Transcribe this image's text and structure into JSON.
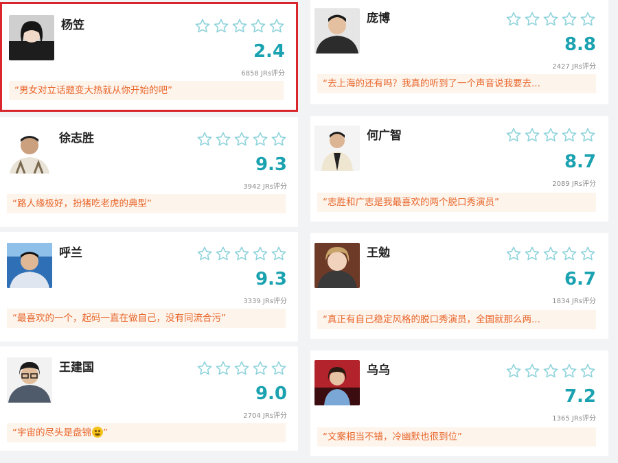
{
  "cards": [
    {
      "name": "杨笠",
      "score": "2.4",
      "count": "6858 JRs评分",
      "quote": "“男女对立话题变大热就从你开始的吧”",
      "rating_stars": 0
    },
    {
      "name": "庞博",
      "score": "8.8",
      "count": "2427 JRs评分",
      "quote": "“去上海的还有吗？我真的听到了一个声音说我要去...",
      "rating_stars": 0
    },
    {
      "name": "徐志胜",
      "score": "9.3",
      "count": "3942 JRs评分",
      "quote": "“路人缘极好，扮猪吃老虎的典型”",
      "rating_stars": 0
    },
    {
      "name": "何广智",
      "score": "8.7",
      "count": "2089 JRs评分",
      "quote": "“志胜和广志是我最喜欢的两个脱口秀演员”",
      "rating_stars": 0
    },
    {
      "name": "呼兰",
      "score": "9.3",
      "count": "3339 JRs评分",
      "quote": "“最喜欢的一个，起码一直在做自己，没有同流合污”",
      "rating_stars": 0
    },
    {
      "name": "王勉",
      "score": "6.7",
      "count": "1834 JRs评分",
      "quote": "“真正有自己稳定风格的脱口秀演员，全国就那么两...",
      "rating_stars": 0
    },
    {
      "name": "王建国",
      "score": "9.0",
      "count": "2704 JRs评分",
      "quote": "“宇宙的尽头是盘锦",
      "quote_suffix": "”",
      "quote_emoji": "grinning-emoji",
      "rating_stars": 0
    },
    {
      "name": "乌乌",
      "score": "7.2",
      "count": "1365 JRs评分",
      "quote": "“文案相当不错，冷幽默也很到位”",
      "rating_stars": 0
    }
  ],
  "colors": {
    "accent": "#1ba2b0",
    "quote_text": "#e8662a",
    "quote_bg": "#fdf4ec",
    "selection": "#d9262c"
  },
  "icons": {
    "star": "star-outline-icon"
  }
}
